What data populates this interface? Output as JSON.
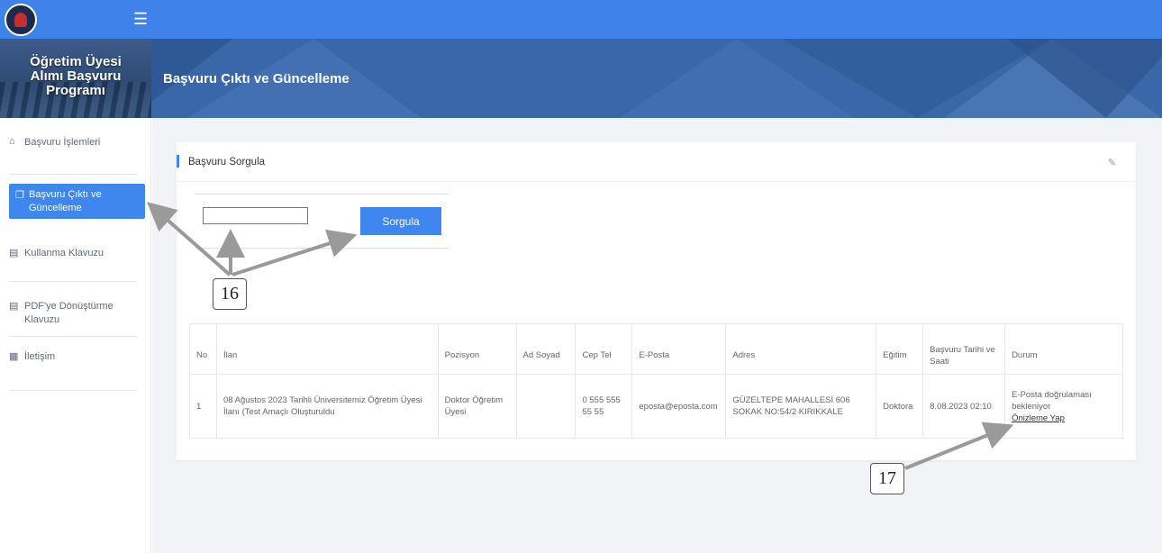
{
  "app": {
    "title": "Öğretim Üyesi\nAlımı Başvuru\nProgramı",
    "page_title": "Başvuru Çıktı ve Güncelleme"
  },
  "colors": {
    "accent": "#3f86ee",
    "topbar": "#3f82ea",
    "header": "#3a67a8"
  },
  "sidebar": {
    "items": [
      {
        "label": "Başvuru İşlemleri",
        "icon": "home-icon",
        "active": false
      },
      {
        "label": "Başvuru Çıktı ve\nGüncelleme",
        "icon": "copy-icon",
        "active": true
      },
      {
        "label": "Kullanma Klavuzu",
        "icon": "book-icon",
        "active": false
      },
      {
        "label": "PDF'ye Dönüştürme\nKlavuzu",
        "icon": "book-icon",
        "active": false
      },
      {
        "label": "İletişim",
        "icon": "contact-card-icon",
        "active": false
      }
    ]
  },
  "card": {
    "title": "Başvuru Sorgula",
    "search_value": "",
    "search_button": "Sorgula"
  },
  "table": {
    "headers": [
      "No",
      "İlan",
      "Pozisyon",
      "Ad Soyad",
      "Cep Tel",
      "E-Posta",
      "Adres",
      "Eğitim",
      "Başvuru Tarihi ve Saati",
      "Durum"
    ],
    "rows": [
      {
        "no": "1",
        "ilan": "08 Ağustos 2023 Tarihli Üniversitemiz Öğretim Üyesi İlanı (Test Amaçlı Oluşturuldu",
        "pozisyon": "Doktor Öğretim Üyesi",
        "ad_soyad": "",
        "cep_tel": "0 555 555 55 55",
        "eposta": "eposta@eposta.com",
        "adres": "GÜZELTEPE MAHALLESİ 606 SOKAK NO:54/2 KIRIKKALE",
        "egitim": "Doktora",
        "tarih": "8.08.2023 02:10",
        "durum": "E-Posta doğrulaması bekleniyor",
        "link": "Önizleme Yap"
      }
    ]
  },
  "callouts": {
    "first": "16",
    "second": "17"
  }
}
